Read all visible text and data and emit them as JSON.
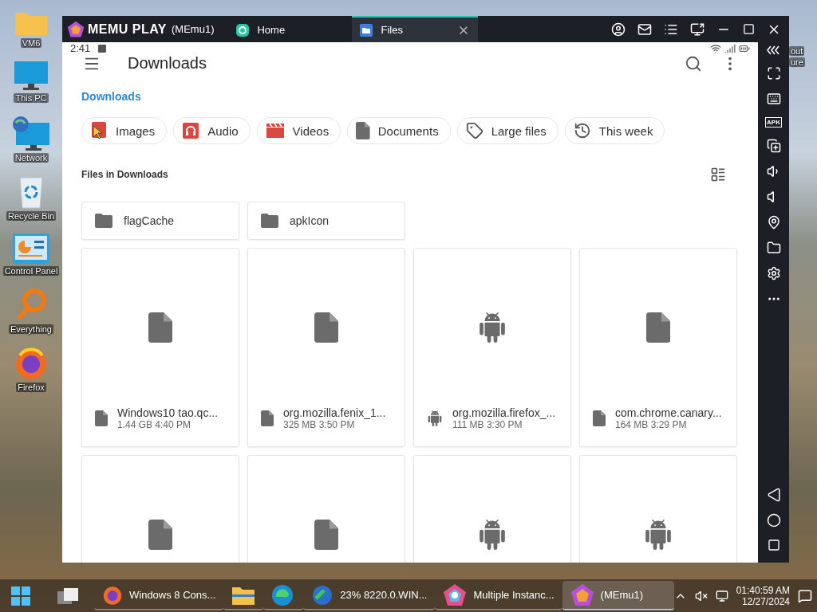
{
  "desktop_icons": [
    {
      "label": "VM6",
      "kind": "folder"
    },
    {
      "label": "This PC",
      "kind": "monitor"
    },
    {
      "label": "Network",
      "kind": "network"
    },
    {
      "label": "Recycle Bin",
      "kind": "bin"
    },
    {
      "label": "Control Panel",
      "kind": "panel"
    },
    {
      "label": "Everything",
      "kind": "search"
    },
    {
      "label": "Firefox",
      "kind": "firefox"
    }
  ],
  "partial_icon_label": [
    "out",
    "ure"
  ],
  "emulator": {
    "brand": "MEMU PLAY",
    "instance": "(MEmu1)",
    "tabs": [
      {
        "label": "Home",
        "selected": false
      },
      {
        "label": "Files",
        "selected": true
      }
    ],
    "apk_label": "APK"
  },
  "status_bar": {
    "time": "2:41"
  },
  "app_bar": {
    "title": "Downloads"
  },
  "breadcrumb": "Downloads",
  "chips": [
    {
      "label": "Images",
      "kind": "images"
    },
    {
      "label": "Audio",
      "kind": "audio"
    },
    {
      "label": "Videos",
      "kind": "videos"
    },
    {
      "label": "Documents",
      "kind": "documents"
    },
    {
      "label": "Large files",
      "kind": "tag"
    },
    {
      "label": "This week",
      "kind": "history"
    }
  ],
  "section_title": "Files in Downloads",
  "folders": [
    {
      "name": "flagCache"
    },
    {
      "name": "apkIcon"
    }
  ],
  "files": [
    {
      "name": "Windows10 tao.qc...",
      "meta": "1.44 GB 4:40 PM",
      "kind": "document"
    },
    {
      "name": "org.mozilla.fenix_1...",
      "meta": "325 MB 3:50 PM",
      "kind": "document"
    },
    {
      "name": "org.mozilla.firefox_...",
      "meta": "111 MB 3:30 PM",
      "kind": "android"
    },
    {
      "name": "com.chrome.canary...",
      "meta": "164 MB 3:29 PM",
      "kind": "document"
    },
    {
      "kind": "document"
    },
    {
      "kind": "document"
    },
    {
      "kind": "android"
    },
    {
      "kind": "android"
    }
  ],
  "taskbar": {
    "apps": [
      {
        "label": "Windows 8 Cons...",
        "kind": "firefox",
        "selected": false
      },
      {
        "kind": "explorer",
        "selected": false
      },
      {
        "kind": "edge",
        "selected": false
      },
      {
        "label": "23% 8220.0.WIN...",
        "kind": "download",
        "selected": false
      },
      {
        "label": "Multiple Instanc...",
        "kind": "multi",
        "selected": false
      },
      {
        "label": "(MEmu1)",
        "kind": "memu",
        "selected": true
      }
    ],
    "time": "01:40:59 AM",
    "date": "12/27/2024"
  }
}
